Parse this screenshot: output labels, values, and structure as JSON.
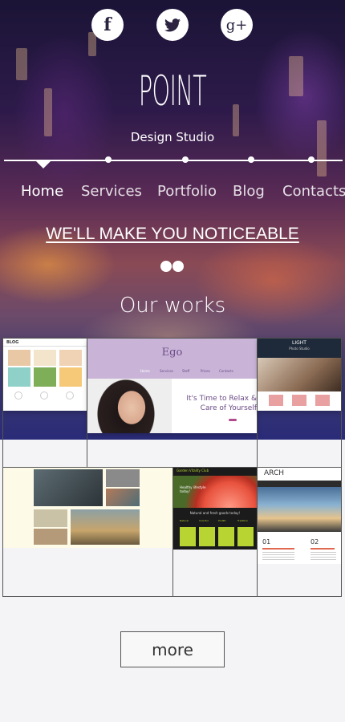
{
  "social": {
    "facebook": "f",
    "twitter": "twitter",
    "googleplus": "g+"
  },
  "brand": {
    "logo": "POINT",
    "tagline": "Design Studio"
  },
  "nav": {
    "items": [
      "Home",
      "Services",
      "Portfolio",
      "Blog",
      "Contacts"
    ],
    "active": "Home"
  },
  "hero": {
    "headline": "WE'LL MAKE YOU NOTICEABLE"
  },
  "works": {
    "title": "Our works",
    "thumb1": {
      "logo": "BLOG"
    },
    "thumb2": {
      "logo": "Ego",
      "menu": [
        "Home",
        "Services",
        "Staff",
        "Prices",
        "Contacts"
      ],
      "text1": "It's Time to Relax &",
      "text2": "Care of Yourself"
    },
    "thumb3": {
      "logo": "LIGHT",
      "sub": "Photo Studio"
    },
    "thumb5": {
      "logo": "Garden Vitality Club",
      "banner": "Healthy lifestyle today!",
      "cols": [
        "Natural",
        "Colorful",
        "Prolific",
        "Tradition"
      ],
      "note": "Natural and fresh goods today!"
    },
    "thumb6": {
      "logo": "ARCH",
      "n1": "01",
      "n2": "02"
    },
    "more_label": "more"
  },
  "colors": {
    "accent_purple": "#c9b4d8",
    "accent_green": "#b7d433",
    "dark": "#1f2833"
  }
}
